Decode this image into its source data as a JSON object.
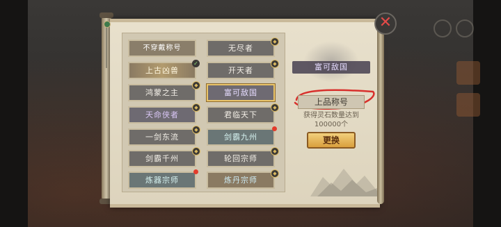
{
  "titles": [
    {
      "label": "不穿戴称号"
    },
    {
      "label": "无尽者"
    },
    {
      "label": "上古凶兽"
    },
    {
      "label": "开天者"
    },
    {
      "label": "鸿蒙之主"
    },
    {
      "label": "富可敌国"
    },
    {
      "label": "天命侠者"
    },
    {
      "label": "君临天下"
    },
    {
      "label": "一剑东流"
    },
    {
      "label": "剑霸九州"
    },
    {
      "label": "剑霸千州"
    },
    {
      "label": "轮回宗师"
    },
    {
      "label": "炼器宗师"
    },
    {
      "label": "炼丹宗师"
    }
  ],
  "detail": {
    "selected_title": "富可敌国",
    "grade": "上品称号",
    "condition_line1": "获得灵石数量达到",
    "condition_line2": "100000个",
    "change_button": "更换"
  },
  "close_glyph": "✕",
  "colors": {
    "accent": "#e9c46a",
    "close": "#e34a48",
    "button": "#d99f3d"
  }
}
